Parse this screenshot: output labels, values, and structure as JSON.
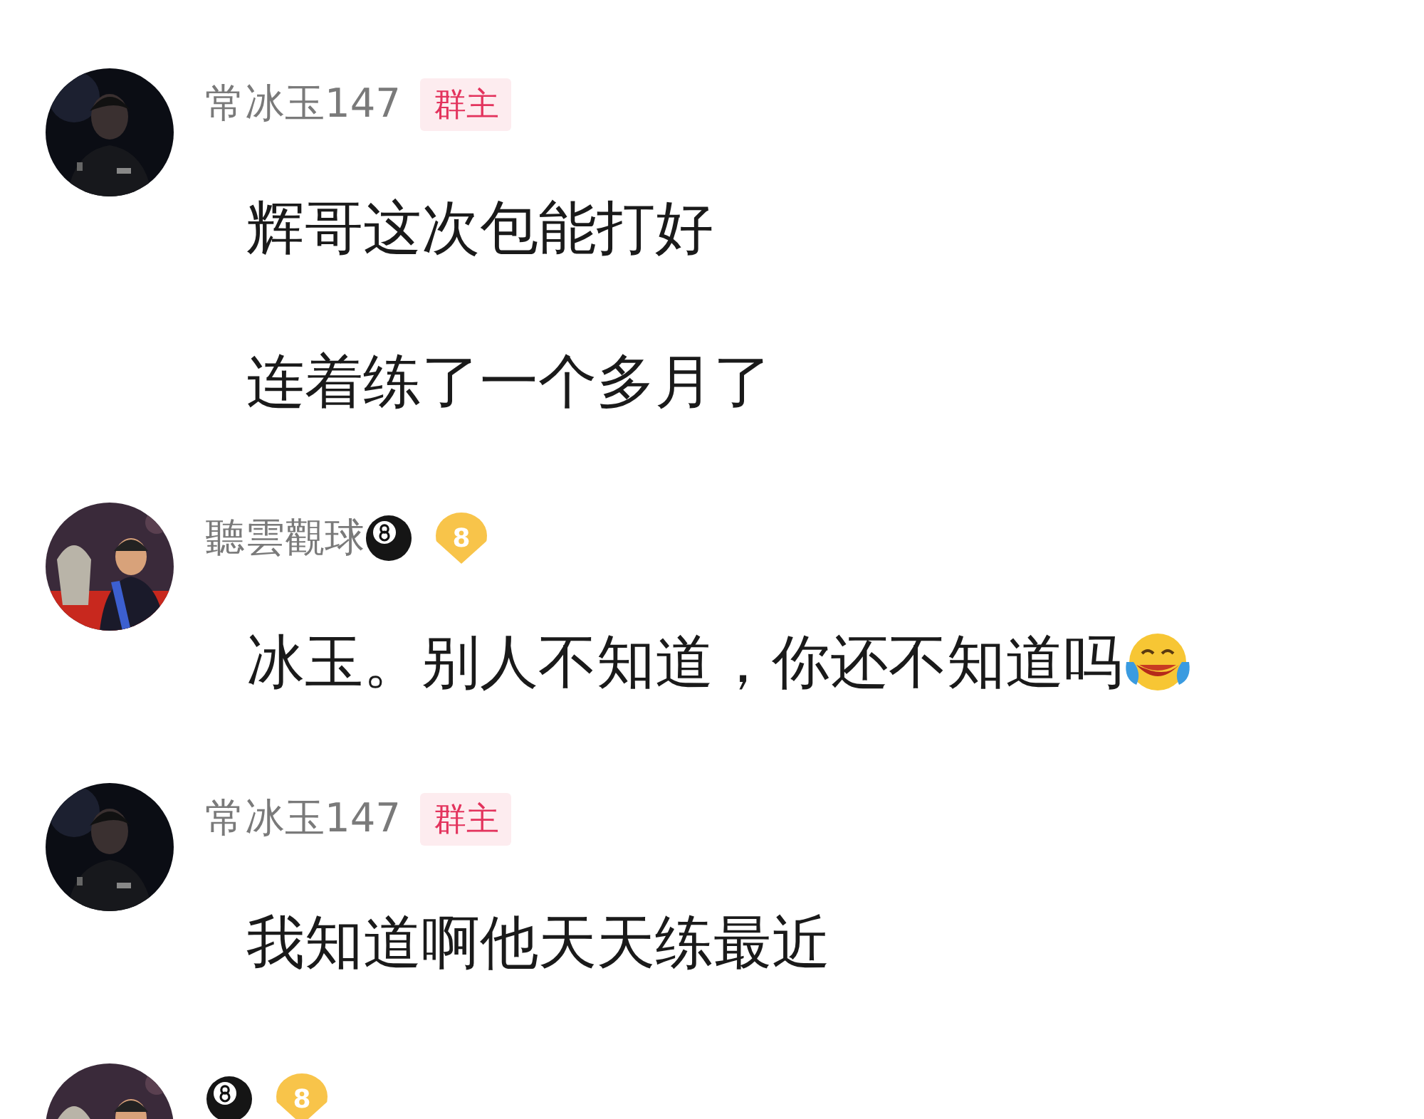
{
  "comments": [
    {
      "name": "常冰玉147",
      "name_icon": false,
      "badge": {
        "kind": "role",
        "label": "群主"
      },
      "messages": [
        {
          "text": "辉哥这次包能打好",
          "emoji": false
        },
        {
          "text": "连着练了一个多月了",
          "emoji": false
        }
      ]
    },
    {
      "name": "聽雲觀球",
      "name_icon": true,
      "badge": {
        "kind": "level",
        "label": "8"
      },
      "messages": [
        {
          "text": "冰玉。别人不知道，你还不知道吗",
          "emoji": true
        }
      ]
    },
    {
      "name": "常冰玉147",
      "name_icon": false,
      "badge": {
        "kind": "role",
        "label": "群主"
      },
      "messages": [
        {
          "text": "我知道啊他天天练最近",
          "emoji": false
        }
      ]
    },
    {
      "name_icon": true,
      "badge": {
        "kind": "level",
        "label": "8"
      }
    }
  ]
}
